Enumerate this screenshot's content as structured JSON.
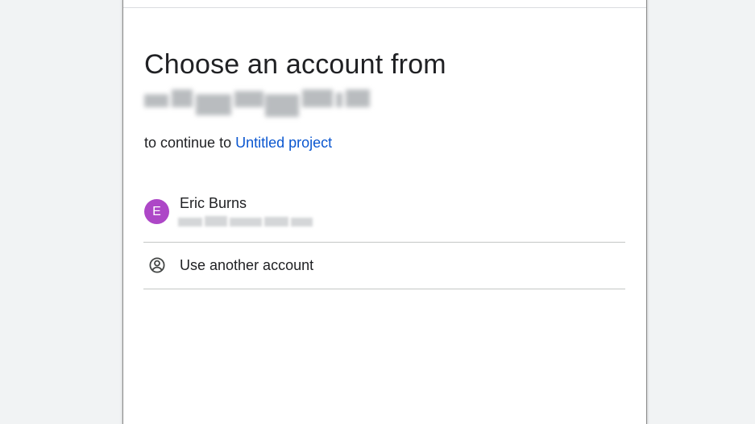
{
  "dialog": {
    "heading": "Choose an account from",
    "subtitle_prefix": "to continue to ",
    "subtitle_link": "Untitled project"
  },
  "accounts": [
    {
      "name": "Eric Burns",
      "avatar_letter": "E",
      "avatar_color": "#ad47c7"
    }
  ],
  "use_another_label": "Use another account",
  "colors": {
    "link": "#0b57d0",
    "text": "#202124",
    "divider": "#c4c7c5",
    "background": "#f1f3f4"
  },
  "icons": {
    "use_another": "account-circle-icon"
  }
}
